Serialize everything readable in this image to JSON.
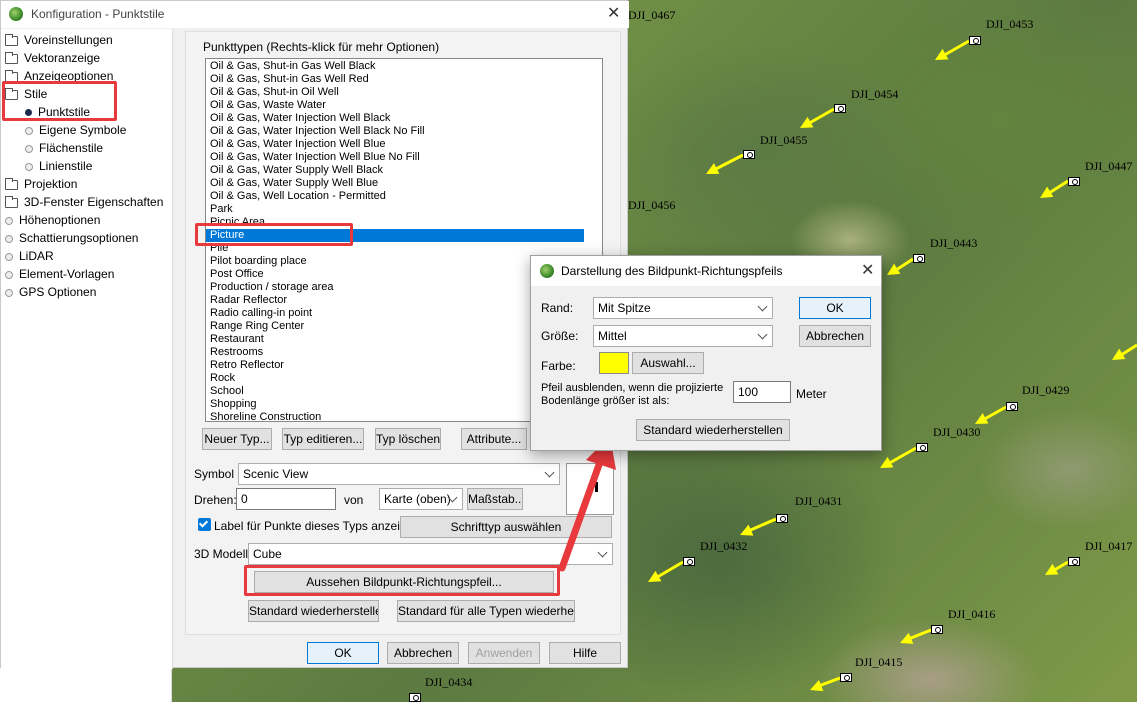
{
  "map": {
    "labels": [
      "DJI_0467",
      "DJI_0453",
      "DJI_0454",
      "DJI_0455",
      "DJI_0447",
      "DJI_0456",
      "DJI_0443",
      "DJI_0429",
      "DJI_0430",
      "DJI_0431",
      "DJI_0432",
      "DJI_0417",
      "DJI_0416",
      "DJI_0415",
      "DJI_0434"
    ],
    "arrow_color": "#ffff00"
  },
  "left_panel": {
    "items": [
      {
        "label": "Voreinstellungen",
        "icon": "folder-icon"
      },
      {
        "label": "Vektoranzeige",
        "icon": "folder-icon"
      },
      {
        "label": "Anzeigeoptionen",
        "icon": "folder-icon"
      },
      {
        "label": "Stile",
        "icon": "folder-open-icon"
      },
      {
        "label": "Punktstile",
        "icon": "selected-dot-icon"
      },
      {
        "label": "Eigene Symbole",
        "icon": "radio-icon"
      },
      {
        "label": "Flächenstile",
        "icon": "radio-icon"
      },
      {
        "label": "Linienstile",
        "icon": "radio-icon"
      },
      {
        "label": "Projektion",
        "icon": "folder-icon"
      },
      {
        "label": "3D-Fenster Eigenschaften",
        "icon": "folder-icon"
      },
      {
        "label": "Höhenoptionen",
        "icon": "radio-icon"
      },
      {
        "label": "Schattierungsoptionen",
        "icon": "radio-icon"
      },
      {
        "label": "LiDAR",
        "icon": "radio-icon"
      },
      {
        "label": "Element-Vorlagen",
        "icon": "radio-icon"
      },
      {
        "label": "GPS Optionen",
        "icon": "radio-icon"
      }
    ]
  },
  "dialog": {
    "title": "Konfiguration - Punktstile",
    "group_label": "Punkttypen (Rechts-klick für mehr Optionen)",
    "list_items": [
      "Oil & Gas, Shut-in Gas Well Black",
      "Oil & Gas, Shut-in Gas Well Red",
      "Oil & Gas, Shut-in Oil Well",
      "Oil & Gas, Waste Water",
      "Oil & Gas, Water Injection Well Black",
      "Oil & Gas, Water Injection Well Black No Fill",
      "Oil & Gas, Water Injection Well Blue",
      "Oil & Gas, Water Injection Well Blue No Fill",
      "Oil & Gas, Water Supply Well Black",
      "Oil & Gas, Water Supply Well Blue",
      "Oil & Gas, Well Location - Permitted",
      "Park",
      "Picnic Area",
      "Picture",
      "Pile",
      "Pilot boarding place",
      "Post Office",
      "Production / storage area",
      "Radar Reflector",
      "Radio calling-in point",
      "Range Ring Center",
      "Restaurant",
      "Restrooms",
      "Retro Reflector",
      "Rock",
      "School",
      "Shopping",
      "Shoreline Construction"
    ],
    "selected_item": "Picture",
    "buttons": {
      "new_type": "Neuer Typ...",
      "edit_type": "Typ editieren...",
      "delete_type": "Typ löschen",
      "attributes": "Attribute...",
      "scale": "Maßstab...",
      "font": "Schrifttyp auswählen",
      "arrow_appearance": "Aussehen Bildpunkt-Richtungspfeil...",
      "restore_default": "Standard wiederherstellen",
      "restore_all": "Standard für alle Typen wiederherst.",
      "ok": "OK",
      "cancel": "Abbrechen",
      "apply": "Anwenden",
      "help": "Hilfe"
    },
    "symbol_label": "Symbol",
    "symbol_value": "Scenic View",
    "rotate_label": "Drehen:",
    "rotate_value": "0",
    "from_label": "von",
    "from_value": "Karte (oben)",
    "show_label_checkbox": "Label für Punkte dieses Typs anzeigen",
    "model_label": "3D Modell",
    "model_value": "Cube"
  },
  "arrow_dialog": {
    "title": "Darstellung des Bildpunkt-Richtungspfeils",
    "border_label": "Rand:",
    "border_value": "Mit Spitze",
    "size_label": "Größe:",
    "size_value": "Mittel",
    "color_label": "Farbe:",
    "color_value": "#ffff00",
    "choose_button": "Auswahl...",
    "hide_label_line1": "Pfeil ausblenden, wenn die projizierte",
    "hide_label_line2": "Bodenlänge größer ist als:",
    "hide_value": "100",
    "unit": "Meter",
    "ok": "OK",
    "cancel": "Abbrechen",
    "restore": "Standard wiederherstellen"
  }
}
